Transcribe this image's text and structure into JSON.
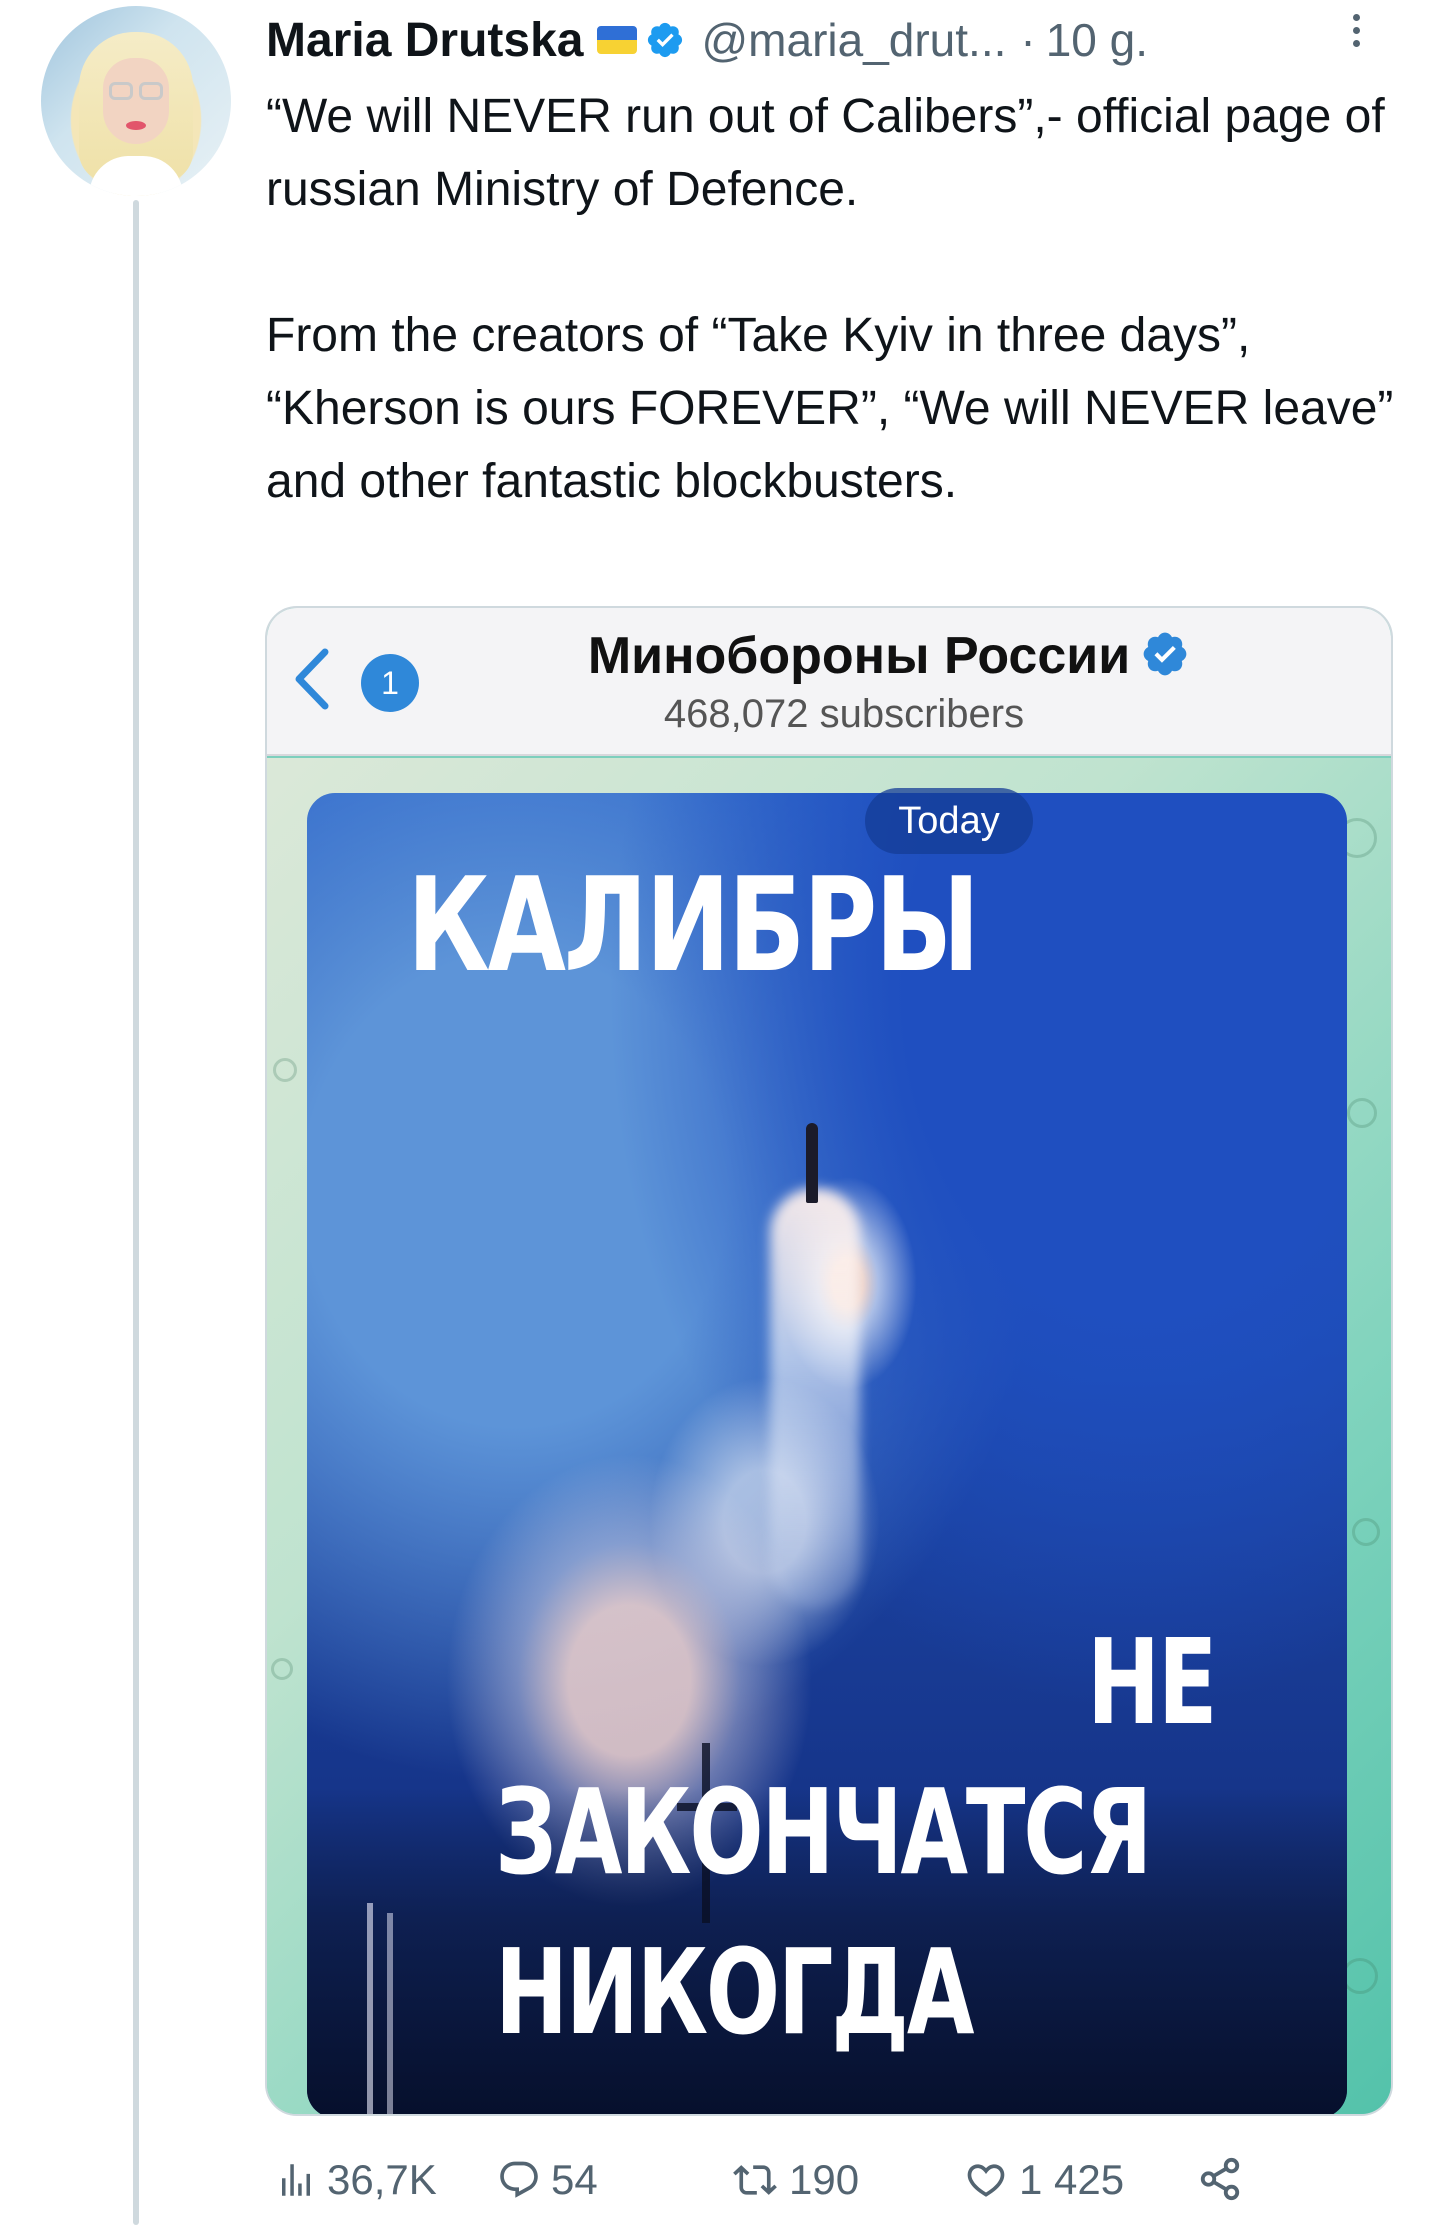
{
  "tweet": {
    "author": {
      "display_name": "Maria Drutska",
      "handle": "@maria_drut...",
      "separator": "·",
      "time": "10 g."
    },
    "text": "“We will NEVER run out of Calibers”,- official page of russian Ministry of Defence.\n\nFrom the creators of “Take Kyiv in three days”, “Kherson is ours FOREVER”, “We will NEVER leave” and other fantastic blockbusters.",
    "media": {
      "telegram": {
        "unread_count": "1",
        "channel_title": "Минобороны России",
        "subscribers": "468,072 subscribers",
        "date_badge": "Today"
      },
      "poster": {
        "line1": "КАЛИБРЫ",
        "line2": "НЕ",
        "line3": "ЗАКОНЧАТСЯ",
        "line4": "НИКОГДА"
      }
    },
    "stats": {
      "views": "36,7K",
      "replies": "54",
      "retweets": "190",
      "likes": "1 425"
    },
    "colors": {
      "verified": "#1d9bf0",
      "text": "#0f1419",
      "secondary": "#536471",
      "flag_blue": "#2f6fd6",
      "flag_yellow": "#f7d233"
    },
    "icons": [
      "verified-badge-icon",
      "ukraine-flag-icon",
      "more-options-icon",
      "views-icon",
      "reply-icon",
      "retweet-icon",
      "like-icon",
      "share-icon",
      "back-arrow-icon"
    ]
  }
}
